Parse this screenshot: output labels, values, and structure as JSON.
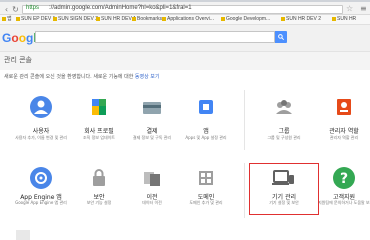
{
  "browser": {
    "url_scheme": "https",
    "url": "://admin.google.com/AdminHome?hl=ko&pli=1&fral=1",
    "bookmarks": [
      "앱",
      "SUN EP DEV 1",
      "SUN SIGN DEV 2",
      "SUN HR DEV 1",
      "Bookmarks",
      "Applications Overvi...",
      "Google Developm...",
      "SUN HR DEV 2",
      "SUN HR"
    ]
  },
  "header": {
    "logo_text": "Google",
    "search_placeholder": ""
  },
  "page": {
    "title": "관리 콘솔",
    "welcome": "새로운 관리 콘솔에 오신 것을 환영합니다. 새로운 기능에 대한",
    "welcome_link": "동영상 보기"
  },
  "tiles": [
    {
      "label": "사용자",
      "desc": "사용자 추가, 이름 변경 및 관리",
      "color": "#4a86e8",
      "icon": "users-icon"
    },
    {
      "label": "회사 프로필",
      "desc": "조직 정보 업데이트",
      "color": "#34a853",
      "icon": "company-profile-icon"
    },
    {
      "label": "결제",
      "desc": "결제 정보 및 구독 관리",
      "color": "#e8e8e8",
      "icon": "billing-icon"
    },
    {
      "label": "앱",
      "desc": "Apps 및 App 설정 관리",
      "color": "#e8e8e8",
      "icon": "apps-icon"
    },
    {
      "label": "그룹",
      "desc": "그룹 및 구성원 관리",
      "color": "#e8e8e8",
      "icon": "groups-icon"
    },
    {
      "label": "관리자 역할",
      "desc": "관리자 역할 관리",
      "color": "#e8e8e8",
      "icon": "admin-roles-icon"
    },
    {
      "label": "App Engine 앱",
      "desc": "Google App Engine 앱 관리",
      "color": "#4a86e8",
      "icon": "app-engine-icon"
    },
    {
      "label": "보안",
      "desc": "보안 기능 설정",
      "color": "#e8e8e8",
      "icon": "security-icon"
    },
    {
      "label": "이전",
      "desc": "데이터 이전",
      "color": "#e8e8e8",
      "icon": "migration-icon"
    },
    {
      "label": "도메인",
      "desc": "도메인 추가 및 관리",
      "color": "#e8e8e8",
      "icon": "domains-icon"
    },
    {
      "label": "기기 관리",
      "desc": "기기 설정 및 보안",
      "color": "#e8e8e8",
      "icon": "device-management-icon"
    },
    {
      "label": "고객지원",
      "desc": "지원팀에 문의하거나 도움말 보기",
      "color": "#34a853",
      "icon": "support-icon"
    }
  ],
  "colors": {
    "accent": "#4d90fe",
    "highlight": "#e03030"
  }
}
